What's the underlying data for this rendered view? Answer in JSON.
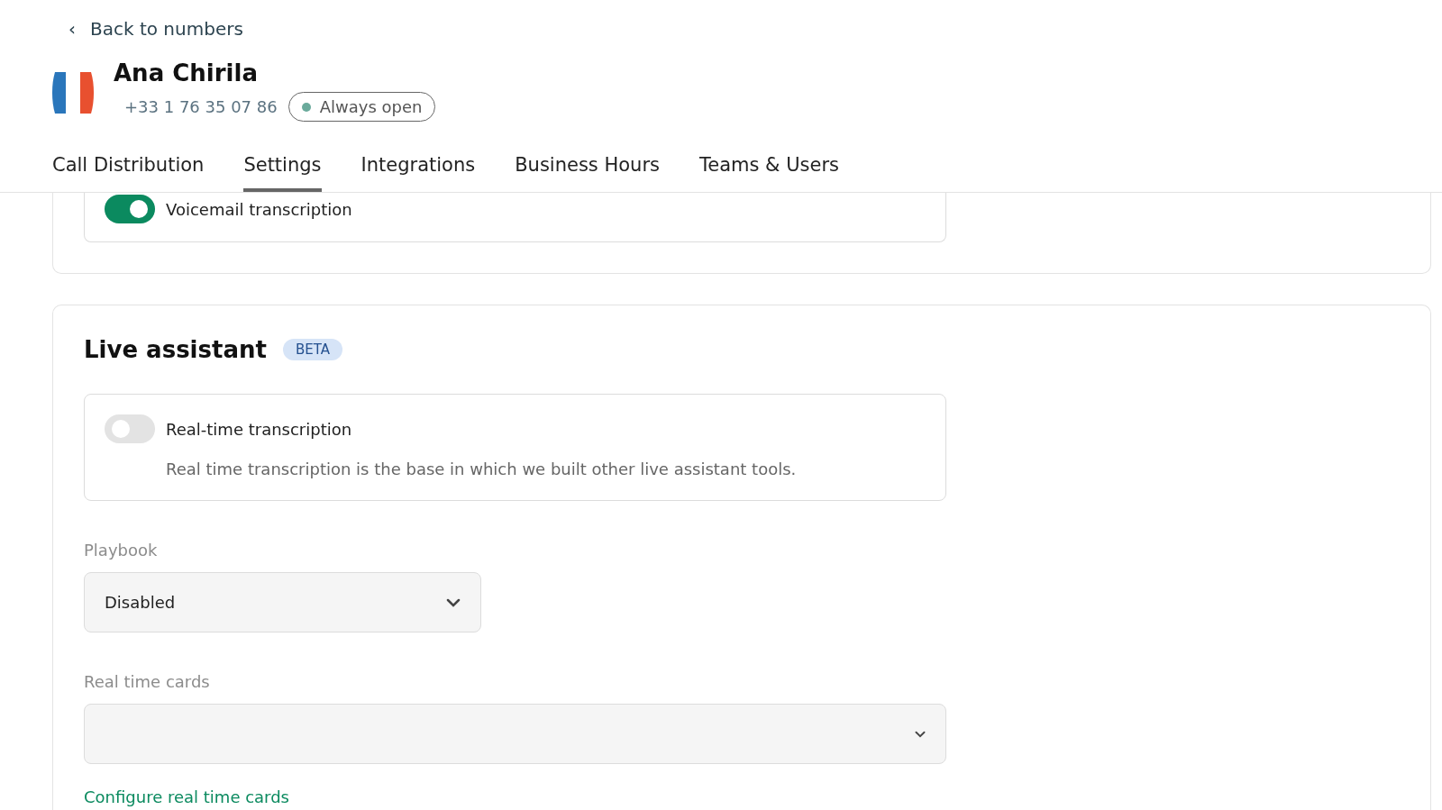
{
  "back_link": {
    "icon": "‹",
    "label": "Back to numbers"
  },
  "number": {
    "name": "Ana Chirila",
    "phone": "+33 1 76 35 07 86",
    "status": {
      "label": "Always open",
      "color": "#6aaa9b"
    }
  },
  "tabs": [
    {
      "label": "Call Distribution",
      "selected": false
    },
    {
      "label": "Settings",
      "selected": true
    },
    {
      "label": "Integrations",
      "selected": false
    },
    {
      "label": "Business Hours",
      "selected": false
    },
    {
      "label": "Teams & Users",
      "selected": false
    }
  ],
  "voicemail_section": {
    "toggles": [
      {
        "label": "Voicemail transcription",
        "on": true
      }
    ]
  },
  "live_assistant": {
    "title": "Live assistant",
    "badge": "BETA",
    "toggles": [
      {
        "label": "Real-time transcription",
        "on": false,
        "description": "Real time transcription is the base in which we built other live assistant tools."
      }
    ],
    "fields": [
      {
        "label": "Playbook",
        "value": "Disabled",
        "kind": "short"
      },
      {
        "label": "Real time cards",
        "kind": "wide"
      }
    ],
    "link": "Configure real time cards"
  }
}
